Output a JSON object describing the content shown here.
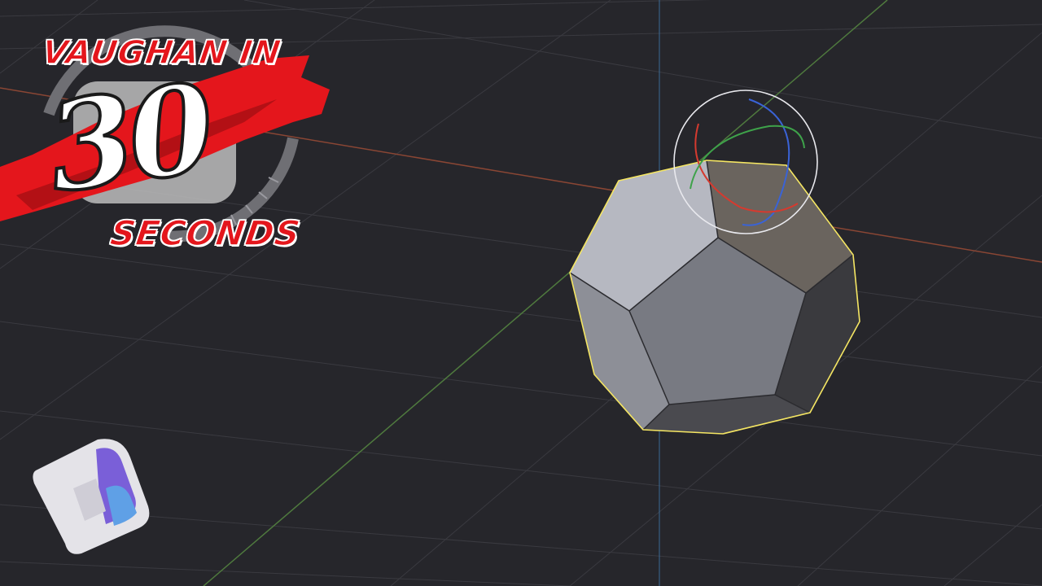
{
  "logo": {
    "line1": "VAUGHAN IN",
    "number": "30",
    "line2": "SECONDS"
  },
  "icons": {
    "badge": "p-app-icon",
    "gizmo": "trackball-rotate-gizmo"
  },
  "colors": {
    "background": "#26262b",
    "grid": "#3a3a40",
    "x_axis": "#8a4634",
    "y_axis": "#4f7a3e",
    "z_axis": "#3b6a96",
    "selection_outline": "#f5e663",
    "logo_red": "#e4161c"
  }
}
